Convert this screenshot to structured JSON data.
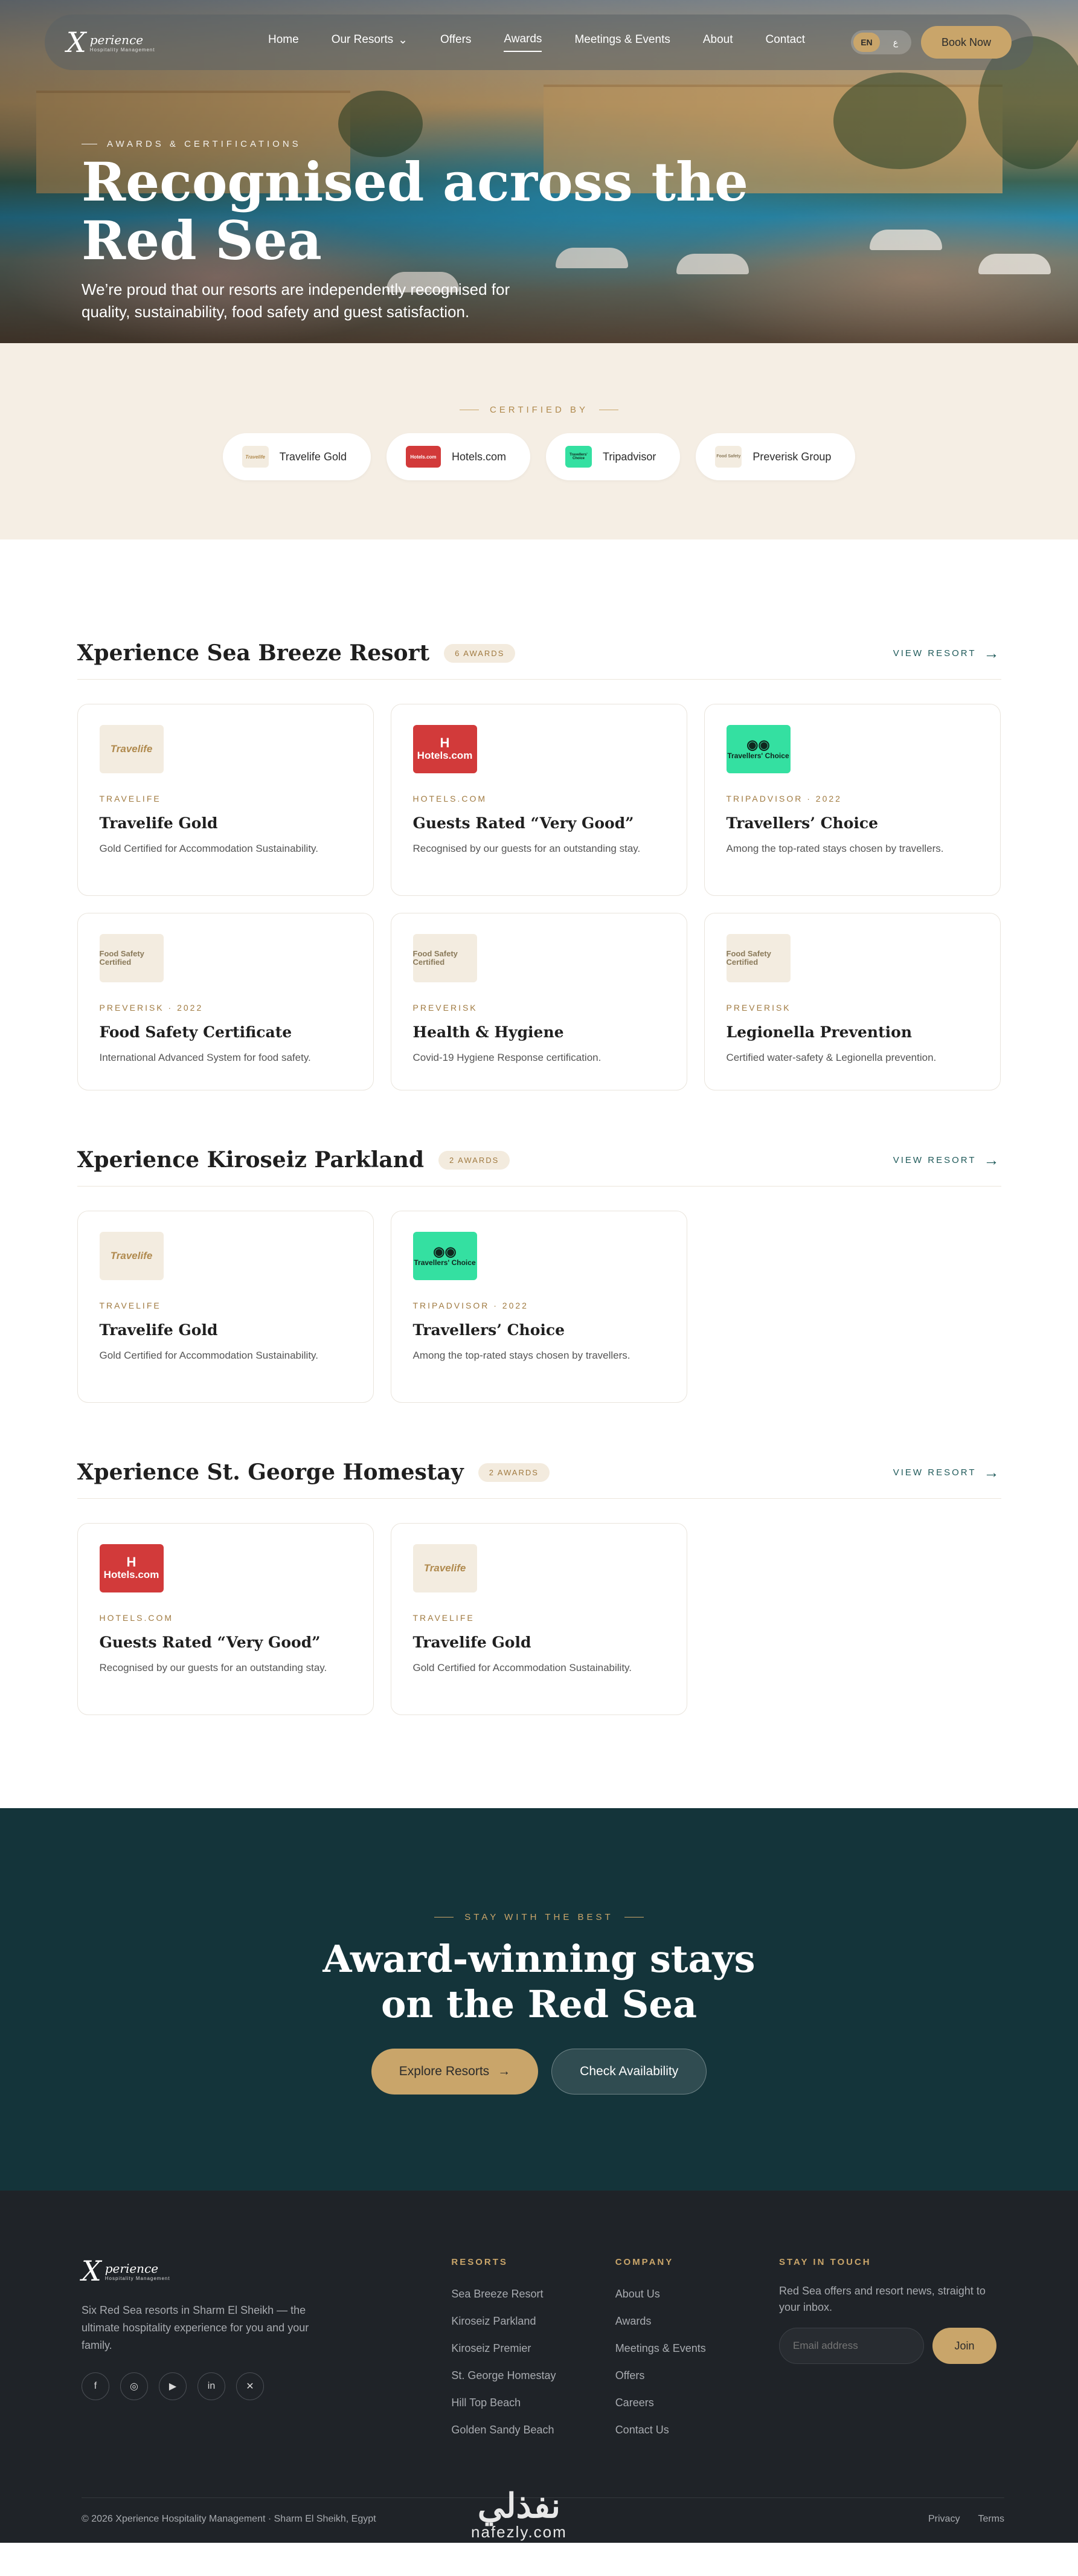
{
  "nav": {
    "logo_mark": "X",
    "logo_word": "perience",
    "logo_sub": "Hospitality Management",
    "links": [
      "Home",
      "Our Resorts",
      "Offers",
      "Awards",
      "Meetings & Events",
      "About",
      "Contact"
    ],
    "active": "Awards",
    "lang_en": "EN",
    "lang_ar": "ع",
    "book_label": "Book Now"
  },
  "hero": {
    "eyebrow": "Awards & Certifications",
    "title": "Recognised across the Red Sea",
    "subtitle": "We’re proud that our resorts are independently recognised for quality, sustainability, food safety and guest satisfaction."
  },
  "certified": {
    "label": "CERTIFIED BY",
    "items": [
      {
        "name": "Travelife Gold",
        "badge_text": "Travelife"
      },
      {
        "name": "Hotels.com",
        "badge_text": "Hotels.com"
      },
      {
        "name": "Tripadvisor",
        "badge_text": "Travellers’ Choice"
      },
      {
        "name": "Preverisk Group",
        "badge_text": "Food Safety"
      }
    ]
  },
  "badges": {
    "travelife": "Travelife",
    "hotels_h": "H",
    "hotels": "Hotels.com",
    "trip_owl": "◉◉",
    "trip": "Travellers' Choice",
    "prev": "Food Safety Certified"
  },
  "resorts": [
    {
      "name": "Xperience Sea Breeze Resort",
      "count": "6 AWARDS",
      "view": "VIEW RESORT",
      "awards": [
        {
          "badge": "travelife",
          "source": "TRAVELIFE",
          "title": "Travelife Gold",
          "desc": "Gold Certified for Accommodation Sustainability."
        },
        {
          "badge": "hotels",
          "source": "HOTELS.COM",
          "title": "Guests Rated “Very Good”",
          "desc": "Recognised by our guests for an outstanding stay."
        },
        {
          "badge": "trip",
          "source": "TRIPADVISOR · 2022",
          "title": "Travellers’ Choice",
          "desc": "Among the top-rated stays chosen by travellers."
        },
        {
          "badge": "prev",
          "source": "PREVERISK · 2022",
          "title": "Food Safety Certificate",
          "desc": "International Advanced System for food safety."
        },
        {
          "badge": "prev",
          "source": "PREVERISK",
          "title": "Health & Hygiene",
          "desc": "Covid-19 Hygiene Response certification."
        },
        {
          "badge": "prev",
          "source": "PREVERISK",
          "title": "Legionella Prevention",
          "desc": "Certified water-safety & Legionella prevention."
        }
      ]
    },
    {
      "name": "Xperience Kiroseiz Parkland",
      "count": "2 AWARDS",
      "view": "VIEW RESORT",
      "awards": [
        {
          "badge": "travelife",
          "source": "TRAVELIFE",
          "title": "Travelife Gold",
          "desc": "Gold Certified for Accommodation Sustainability."
        },
        {
          "badge": "trip",
          "source": "TRIPADVISOR · 2022",
          "title": "Travellers’ Choice",
          "desc": "Among the top-rated stays chosen by travellers."
        }
      ]
    },
    {
      "name": "Xperience St. George Homestay",
      "count": "2 AWARDS",
      "view": "VIEW RESORT",
      "awards": [
        {
          "badge": "hotels",
          "source": "HOTELS.COM",
          "title": "Guests Rated “Very Good”",
          "desc": "Recognised by our guests for an outstanding stay."
        },
        {
          "badge": "travelife",
          "source": "TRAVELIFE",
          "title": "Travelife Gold",
          "desc": "Gold Certified for Accommodation Sustainability."
        }
      ]
    }
  ],
  "cta": {
    "eyebrow": "STAY WITH THE BEST",
    "title": "Award-winning stays on the Red Sea",
    "primary": "Explore Resorts",
    "secondary": "Check Availability"
  },
  "footer": {
    "desc": "Six Red Sea resorts in Sharm El Sheikh — the ultimate hospitality experience for you and your family.",
    "social_icons": [
      "facebook-icon",
      "instagram-icon",
      "youtube-icon",
      "linkedin-icon",
      "twitter-icon"
    ],
    "social_glyphs": [
      "f",
      "◎",
      "▶",
      "in",
      "✕"
    ],
    "resorts_heading": "RESORTS",
    "resorts_links": [
      "Sea Breeze Resort",
      "Kiroseiz Parkland",
      "Kiroseiz Premier",
      "St. George Homestay",
      "Hill Top Beach",
      "Golden Sandy Beach"
    ],
    "company_heading": "COMPANY",
    "company_links": [
      "About Us",
      "Awards",
      "Meetings & Events",
      "Offers",
      "Careers",
      "Contact Us"
    ],
    "touch_heading": "STAY IN TOUCH",
    "touch_text": "Red Sea offers and resort news, straight to your inbox.",
    "email_placeholder": "Email address",
    "join": "Join",
    "copyright": "© 2026 Xperience Hospitality Management · Sharm El Sheikh, Egypt",
    "privacy": "Privacy",
    "terms": "Terms"
  },
  "watermark": {
    "ar": "نفذلي",
    "en": "nafezly.com"
  },
  "colors": {
    "gold": "#c9a56a",
    "teal_dark": "#14343a",
    "cream": "#f5eee4",
    "footer_bg": "#1f2328"
  }
}
